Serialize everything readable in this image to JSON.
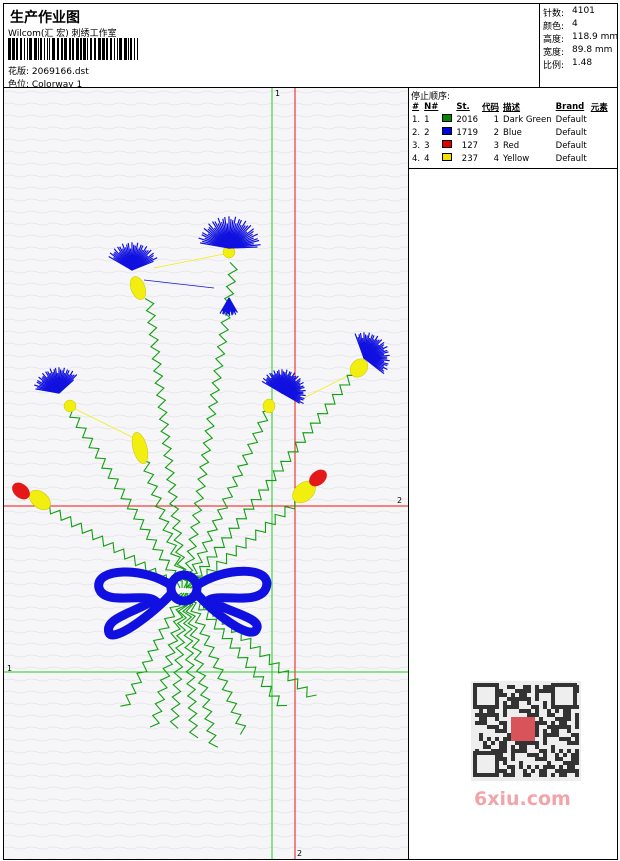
{
  "header": {
    "title": "生产作业图",
    "subtitle": "Wilcom(汇 宏) 刺绣工作室",
    "design_label": "花版: 2069166.dst",
    "colorway_label": "色位: Colorway 1"
  },
  "stats": [
    {
      "label": "针数:",
      "value": "4101"
    },
    {
      "label": "颜色:",
      "value": "4"
    },
    {
      "label": "高度:",
      "value": "118.9 mm"
    },
    {
      "label": "宽度:",
      "value": "89.8 mm"
    },
    {
      "label": "比例:",
      "value": "1.48"
    }
  ],
  "sequence": {
    "title": "停止顺序:",
    "columns": [
      "#",
      "N#",
      "St.",
      "代码",
      "描述",
      "Brand",
      "元素"
    ],
    "rows": [
      {
        "num": "1.",
        "n": "1",
        "color": "#008a00",
        "stitches": "2016",
        "code": "1",
        "desc": "Dark Green",
        "brand": "Default"
      },
      {
        "num": "2.",
        "n": "2",
        "color": "#0000e0",
        "stitches": "1719",
        "code": "2",
        "desc": "Blue",
        "brand": "Default"
      },
      {
        "num": "3.",
        "n": "3",
        "color": "#e00000",
        "stitches": "127",
        "code": "3",
        "desc": "Red",
        "brand": "Default"
      },
      {
        "num": "4.",
        "n": "4",
        "color": "#f0e000",
        "stitches": "237",
        "code": "4",
        "desc": "Yellow",
        "brand": "Default"
      }
    ]
  },
  "guides": {
    "v1": "1",
    "v2": "2",
    "h1": "1",
    "h2": "2"
  },
  "watermark": "6xiu.com",
  "colors": {
    "green": "#12a012",
    "blue": "#1010e0",
    "red": "#e41818",
    "yellow": "#f2ee10",
    "guide_green": "#22cc22",
    "guide_red": "#ee1111"
  }
}
